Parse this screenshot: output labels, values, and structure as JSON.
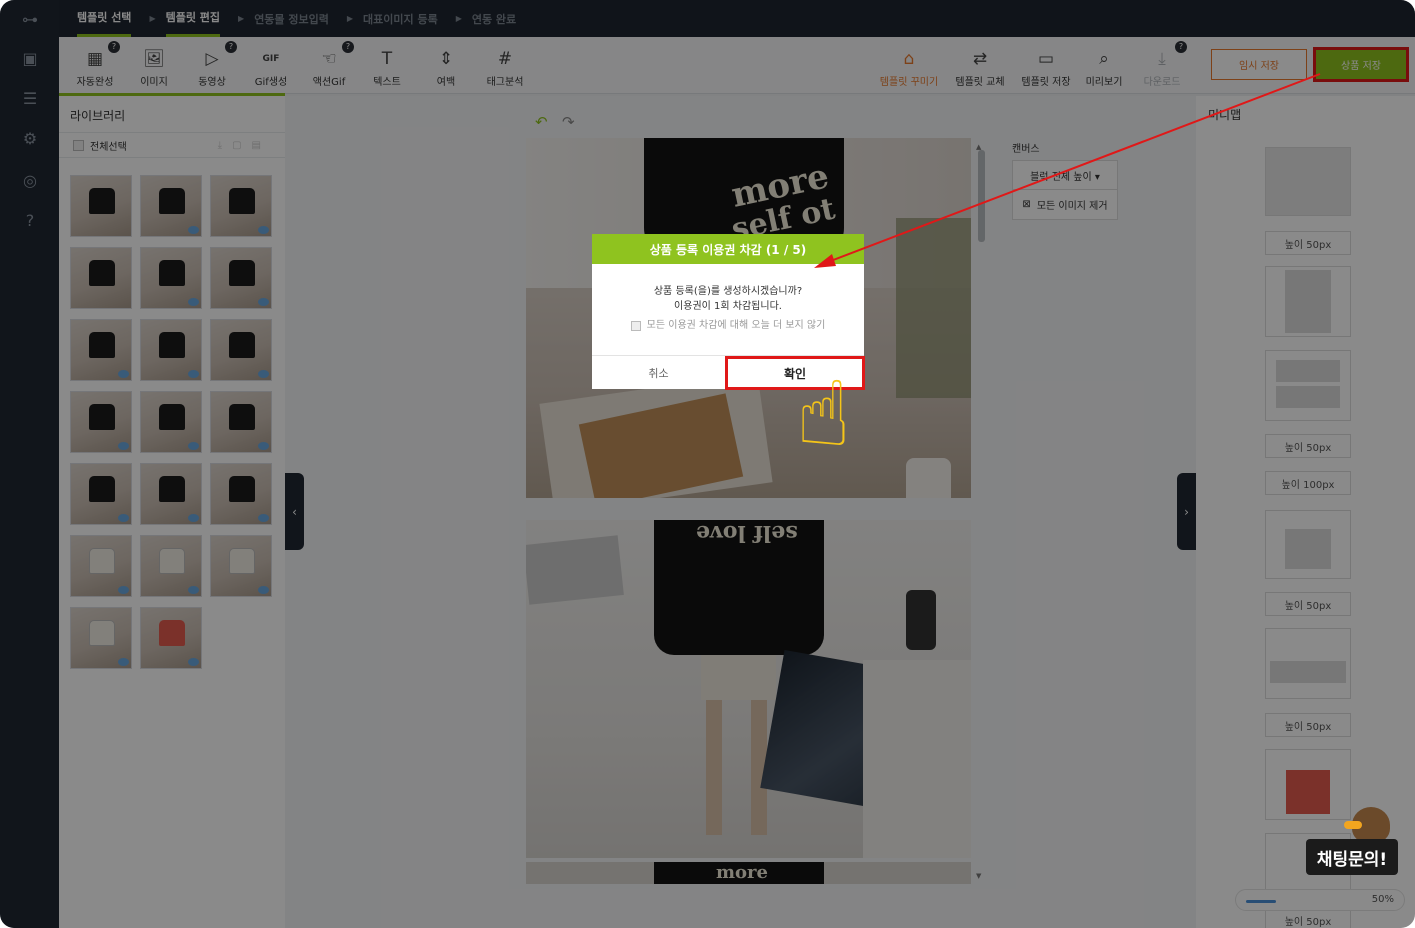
{
  "steps": [
    "템플릿 선택",
    "템플릿 편집",
    "연동몰 정보입력",
    "대표이미지 등록",
    "연동 완료"
  ],
  "tools": [
    {
      "name": "auto-complete",
      "label": "자동완성",
      "icon": "▦",
      "badge": "?"
    },
    {
      "name": "image",
      "label": "이미지",
      "icon": "🖼",
      "badge": ""
    },
    {
      "name": "video",
      "label": "동영상",
      "icon": "▷",
      "badge": "?"
    },
    {
      "name": "gif-create",
      "label": "Gif생성",
      "icon": "GIF",
      "badge": ""
    },
    {
      "name": "action-gif",
      "label": "액션Gif",
      "icon": "☜",
      "badge": "?"
    },
    {
      "name": "text",
      "label": "텍스트",
      "icon": "T",
      "badge": ""
    },
    {
      "name": "spacing",
      "label": "여백",
      "icon": "⇕",
      "badge": ""
    },
    {
      "name": "tag-analysis",
      "label": "태그분석",
      "icon": "#",
      "badge": ""
    }
  ],
  "right_tools": [
    {
      "name": "template-decorate",
      "label": "템플릿 꾸미기",
      "icon": "⌂",
      "style": "orange"
    },
    {
      "name": "template-replace",
      "label": "템플릿 교체",
      "icon": "⇄",
      "style": ""
    },
    {
      "name": "template-save",
      "label": "템플릿 저장",
      "icon": "▭",
      "style": ""
    },
    {
      "name": "preview",
      "label": "미리보기",
      "icon": "⌕",
      "style": ""
    },
    {
      "name": "download",
      "label": "다운로드",
      "icon": "⤓",
      "style": "dim",
      "badge": "?"
    }
  ],
  "buttons": {
    "temp_save": "임시 저장",
    "product_save": "상품 저장"
  },
  "library": {
    "title": "라이브러리",
    "select_all": "전체선택"
  },
  "thumbs": [
    "black",
    "black",
    "black",
    "black",
    "black",
    "black",
    "black",
    "black",
    "black",
    "black",
    "black",
    "black",
    "black",
    "black",
    "black",
    "white",
    "white",
    "white",
    "white",
    "red"
  ],
  "canvas": {
    "label": "캔버스",
    "block_height": "블럭 전체 높이 ▾",
    "remove_images": "모든 이미지 제거"
  },
  "photo_text": {
    "top": "more",
    "top2": "self ot",
    "mid": "self love",
    "bottom": "more"
  },
  "minimap": {
    "title": "미니맵",
    "labels": [
      "높이 50px",
      "높이 50px",
      "높이 100px",
      "높이 50px",
      "높이 50px",
      "높이 50px"
    ],
    "zoom": "50%",
    "zoom_level": 0.3
  },
  "dialog": {
    "title": "상품 등록 이용권 차감 (1 / 5)",
    "line1": "상품 등록(을)를 생성하시겠습니까?",
    "line2": "이용권이 1회 차감됩니다.",
    "checkbox": "모든 이용권 차감에 대해 오늘 더 보지 않기",
    "cancel": "취소",
    "confirm": "확인"
  },
  "chat": "채팅문의!",
  "colors": {
    "accent": "#8fc31f",
    "highlight": "#e01818",
    "orange": "#e8792d"
  }
}
